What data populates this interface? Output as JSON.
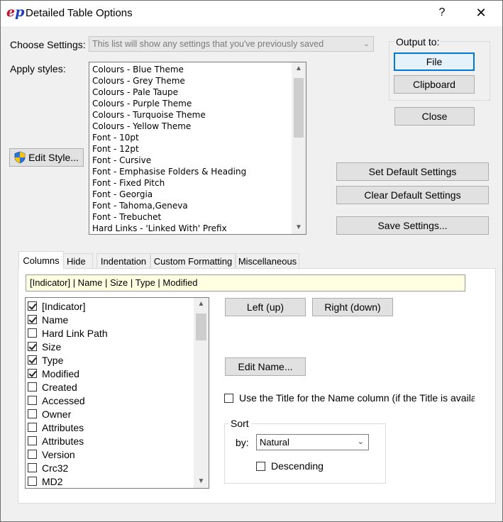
{
  "window": {
    "title": "Detailed Table Options",
    "help_glyph": "?",
    "close_glyph": "✕",
    "app_icon_letters": [
      "e",
      "p"
    ]
  },
  "settings": {
    "choose_label": "Choose Settings:",
    "choose_placeholder": "This list will show any settings that you've previously saved",
    "apply_label": "Apply styles:",
    "styles": [
      "Colours - Blue Theme",
      "Colours - Grey Theme",
      "Colours - Pale Taupe",
      "Colours - Purple Theme",
      "Colours - Turquoise Theme",
      "Colours - Yellow Theme",
      "Font - 10pt",
      "Font - 12pt",
      "Font - Cursive",
      "Font - Emphasise Folders & Heading",
      "Font - Fixed Pitch",
      "Font - Georgia",
      "Font - Tahoma,Geneva",
      "Font - Trebuchet",
      "Hard Links - 'Linked With' Prefix"
    ],
    "edit_style_label": "Edit Style..."
  },
  "output": {
    "label": "Output to:",
    "file_label": "File",
    "clipboard_label": "Clipboard"
  },
  "actions": {
    "close_label": "Close",
    "set_default_label": "Set Default Settings",
    "clear_default_label": "Clear Default Settings",
    "save_label": "Save Settings..."
  },
  "tabs": [
    {
      "label": "Columns"
    },
    {
      "label": "Hide"
    },
    {
      "label": "Indentation"
    },
    {
      "label": "Custom Formatting"
    },
    {
      "label": "Miscellaneous"
    }
  ],
  "active_tab": "Columns",
  "columns": {
    "column_string": "[Indicator] | Name | Size | Type | Modified",
    "items": [
      {
        "label": "[Indicator]",
        "checked": true
      },
      {
        "label": "Name",
        "checked": true
      },
      {
        "label": "Hard Link Path",
        "checked": false
      },
      {
        "label": "Size",
        "checked": true
      },
      {
        "label": "Type",
        "checked": true
      },
      {
        "label": "Modified",
        "checked": true
      },
      {
        "label": "Created",
        "checked": false
      },
      {
        "label": "Accessed",
        "checked": false
      },
      {
        "label": "Owner",
        "checked": false
      },
      {
        "label": "Attributes",
        "checked": false
      },
      {
        "label": "Attributes",
        "checked": false
      },
      {
        "label": "Version",
        "checked": false
      },
      {
        "label": "Crc32",
        "checked": false
      },
      {
        "label": "MD2",
        "checked": false
      }
    ],
    "left_label": "Left (up)",
    "right_label": "Right (down)",
    "edit_name_label": "Edit Name...",
    "use_title_label": "Use the Title for the Name column (if the Title is availab",
    "use_title_checked": false,
    "sort": {
      "legend": "Sort",
      "by_label": "by:",
      "value": "Natural",
      "descending_label": "Descending",
      "descending_checked": false
    }
  }
}
